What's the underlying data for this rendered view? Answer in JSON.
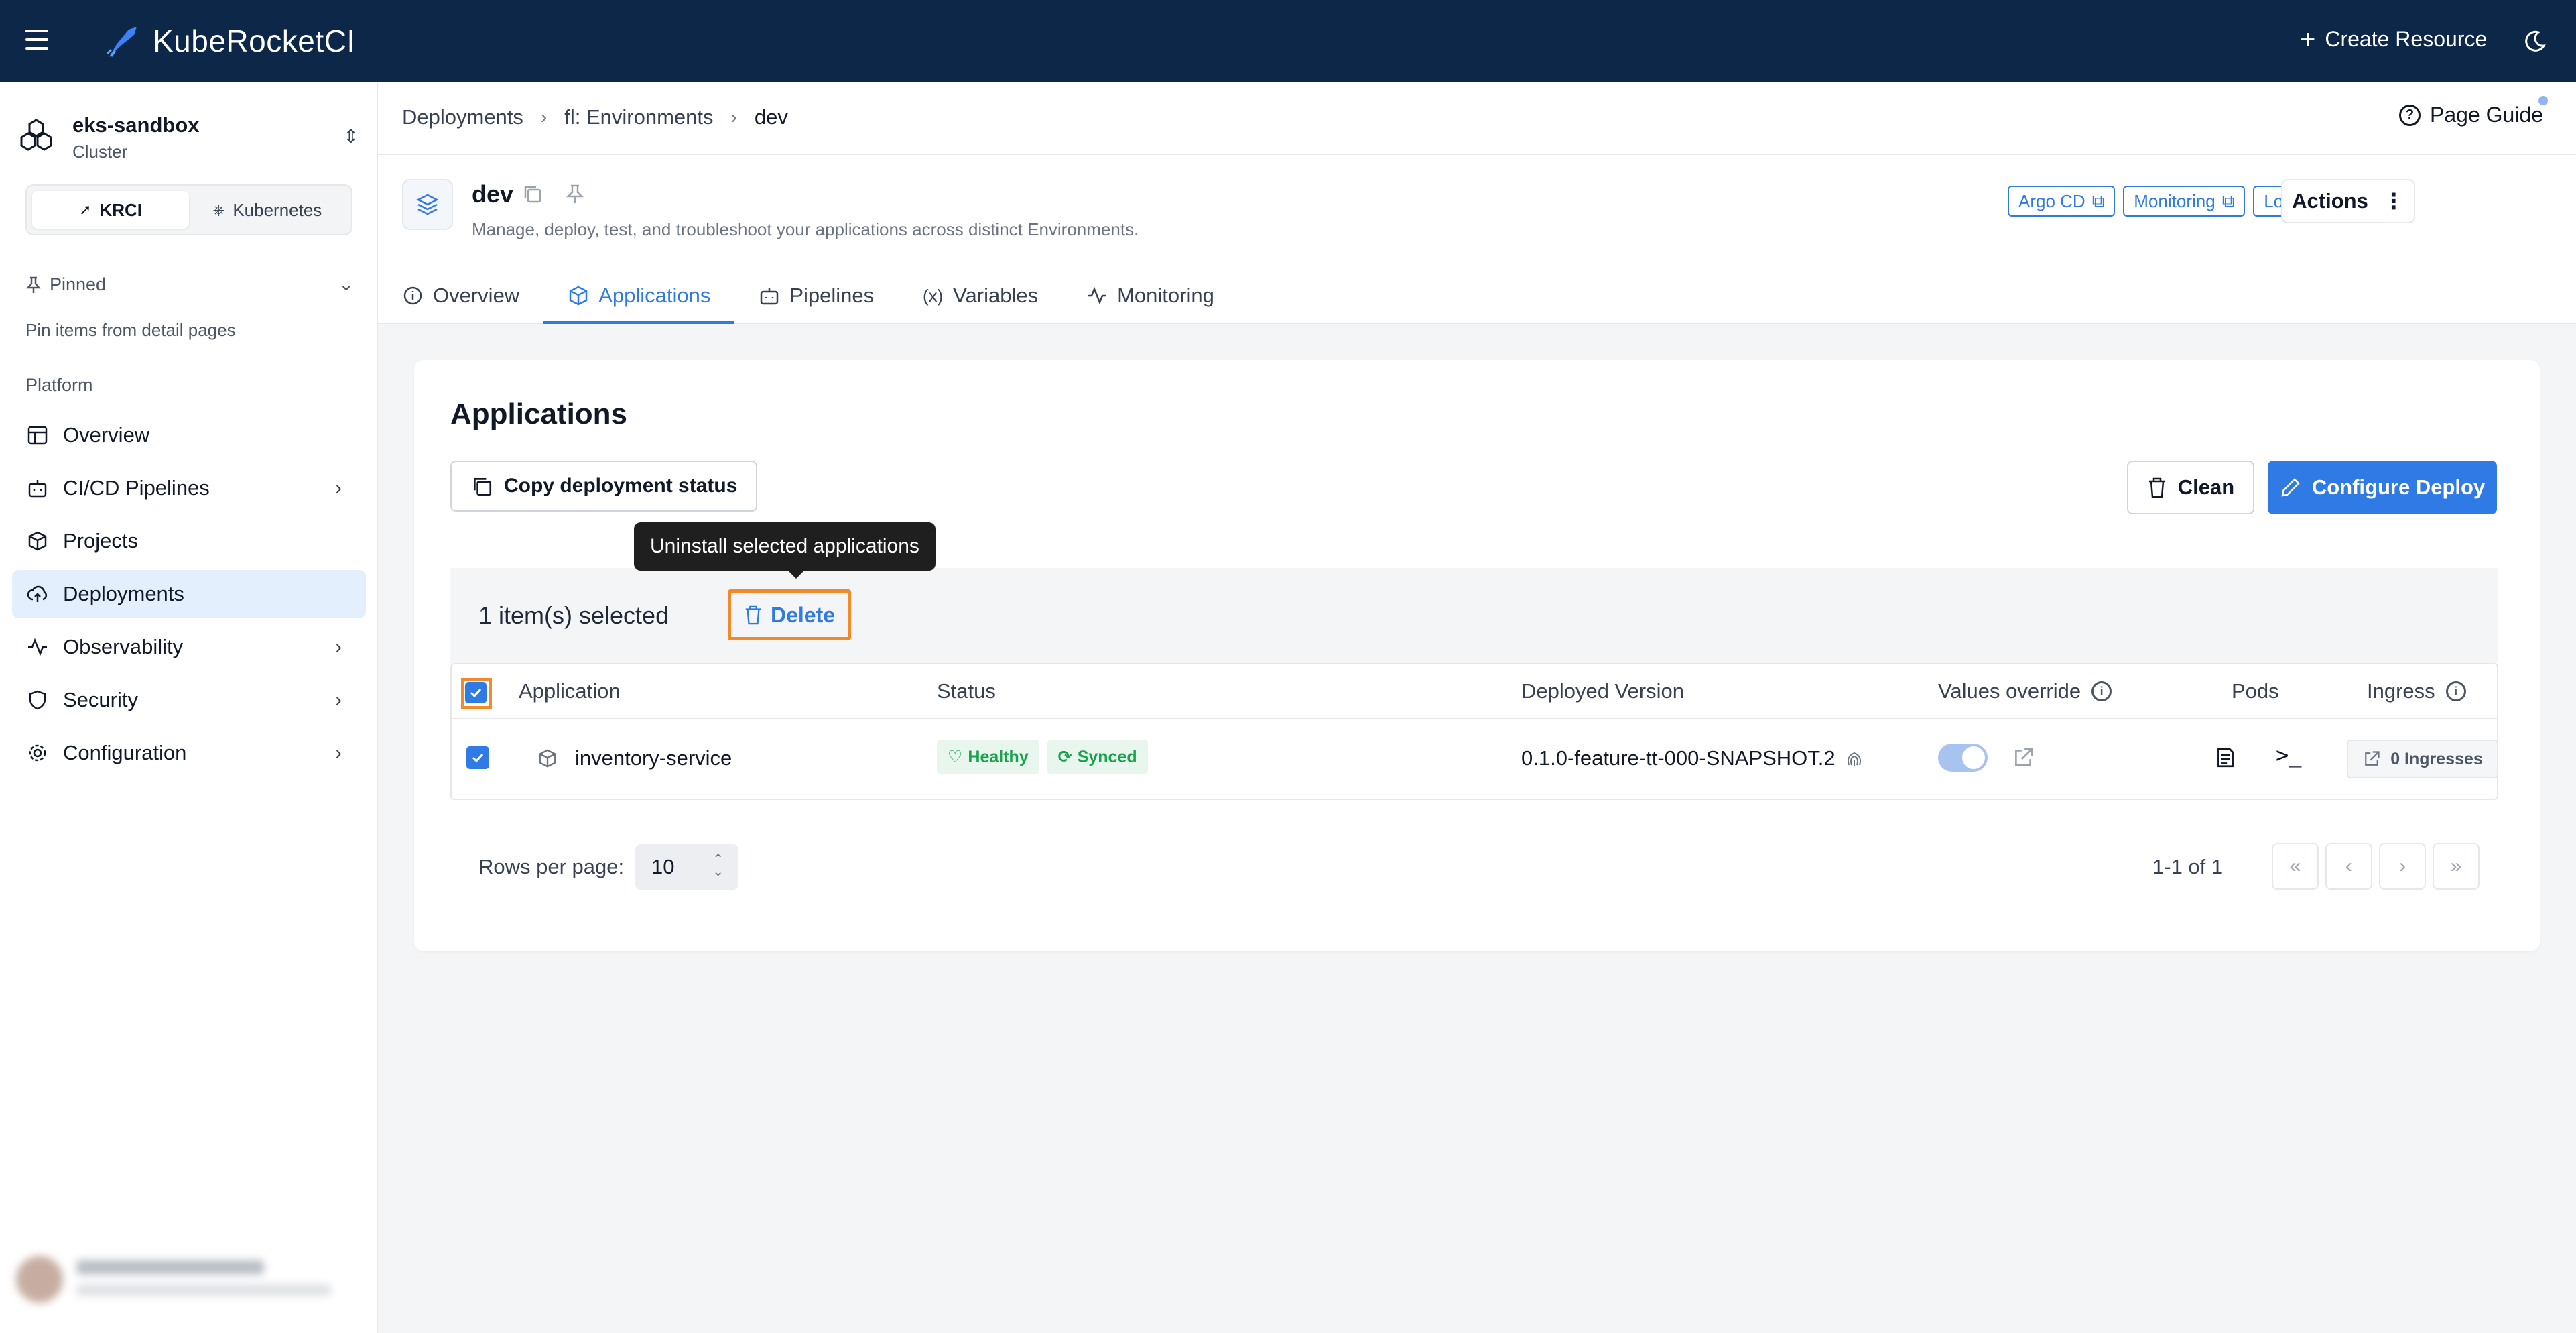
{
  "app": {
    "name": "KubeRocketCI",
    "create_resource": "Create Resource"
  },
  "sidebar": {
    "cluster_name": "eks-sandbox",
    "cluster_type": "Cluster",
    "switcher": [
      "KRCI",
      "Kubernetes"
    ],
    "pinned_label": "Pinned",
    "pinned_hint": "Pin items from detail pages",
    "section_label": "Platform",
    "items": [
      {
        "label": "Overview",
        "icon": "layout-icon",
        "has_children": false
      },
      {
        "label": "CI/CD Pipelines",
        "icon": "bot-icon",
        "has_children": true
      },
      {
        "label": "Projects",
        "icon": "box-icon",
        "has_children": false
      },
      {
        "label": "Deployments",
        "icon": "cloud-upload-icon",
        "has_children": false,
        "active": true
      },
      {
        "label": "Observability",
        "icon": "activity-icon",
        "has_children": true
      },
      {
        "label": "Security",
        "icon": "shield-icon",
        "has_children": true
      },
      {
        "label": "Configuration",
        "icon": "gear-icon",
        "has_children": true
      }
    ]
  },
  "breadcrumbs": [
    "Deployments",
    "fl: Environments",
    "dev"
  ],
  "page_guide": "Page Guide",
  "environment": {
    "name": "dev",
    "description": "Manage, deploy, test, and troubleshoot your applications across distinct Environments.",
    "links": [
      "Argo CD",
      "Monitoring",
      "Logging"
    ],
    "actions_label": "Actions"
  },
  "tabs": [
    "Overview",
    "Applications",
    "Pipelines",
    "Variables",
    "Monitoring"
  ],
  "active_tab": "Applications",
  "applications": {
    "title": "Applications",
    "copy_status_label": "Copy deployment status",
    "clean_label": "Clean",
    "configure_label": "Configure Deploy",
    "tooltip": "Uninstall selected applications",
    "selection_text": "1 item(s) selected",
    "delete_label": "Delete",
    "columns": [
      "Application",
      "Status",
      "Deployed Version",
      "Values override",
      "Pods",
      "Ingress"
    ],
    "rows": [
      {
        "name": "inventory-service",
        "health": "Healthy",
        "sync": "Synced",
        "version": "0.1.0-feature-tt-000-SNAPSHOT.2",
        "values_override": true,
        "ingress": "0 Ingresses",
        "selected": true
      }
    ],
    "rows_per_page_label": "Rows per page:",
    "rows_per_page": "10",
    "range": "1-1 of 1"
  },
  "colors": {
    "topbar": "#0c2748",
    "accent": "#2f7ae5",
    "highlight": "#f28a2c",
    "success": "#16a34a"
  }
}
